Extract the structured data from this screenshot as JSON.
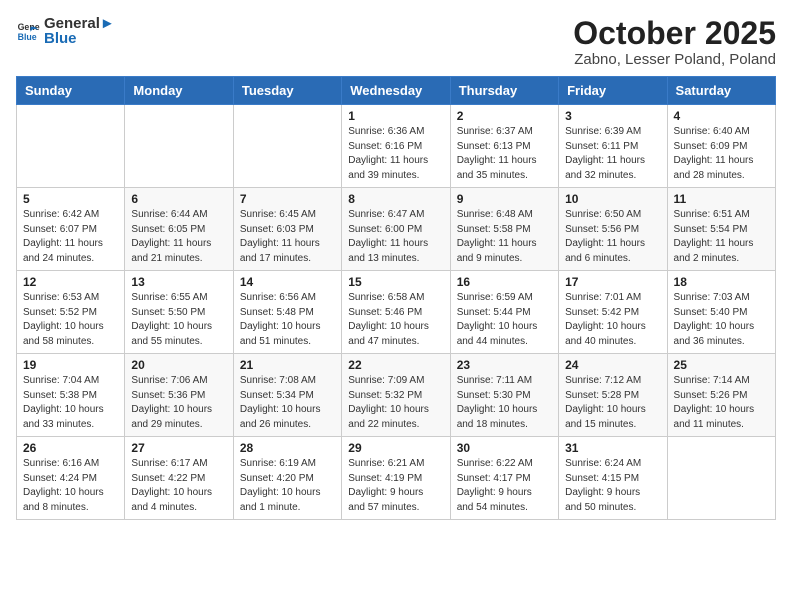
{
  "header": {
    "logo_general": "General",
    "logo_blue": "Blue",
    "month_title": "October 2025",
    "subtitle": "Zabno, Lesser Poland, Poland"
  },
  "weekdays": [
    "Sunday",
    "Monday",
    "Tuesday",
    "Wednesday",
    "Thursday",
    "Friday",
    "Saturday"
  ],
  "weeks": [
    [
      {
        "day": "",
        "info": ""
      },
      {
        "day": "",
        "info": ""
      },
      {
        "day": "",
        "info": ""
      },
      {
        "day": "1",
        "info": "Sunrise: 6:36 AM\nSunset: 6:16 PM\nDaylight: 11 hours\nand 39 minutes."
      },
      {
        "day": "2",
        "info": "Sunrise: 6:37 AM\nSunset: 6:13 PM\nDaylight: 11 hours\nand 35 minutes."
      },
      {
        "day": "3",
        "info": "Sunrise: 6:39 AM\nSunset: 6:11 PM\nDaylight: 11 hours\nand 32 minutes."
      },
      {
        "day": "4",
        "info": "Sunrise: 6:40 AM\nSunset: 6:09 PM\nDaylight: 11 hours\nand 28 minutes."
      }
    ],
    [
      {
        "day": "5",
        "info": "Sunrise: 6:42 AM\nSunset: 6:07 PM\nDaylight: 11 hours\nand 24 minutes."
      },
      {
        "day": "6",
        "info": "Sunrise: 6:44 AM\nSunset: 6:05 PM\nDaylight: 11 hours\nand 21 minutes."
      },
      {
        "day": "7",
        "info": "Sunrise: 6:45 AM\nSunset: 6:03 PM\nDaylight: 11 hours\nand 17 minutes."
      },
      {
        "day": "8",
        "info": "Sunrise: 6:47 AM\nSunset: 6:00 PM\nDaylight: 11 hours\nand 13 minutes."
      },
      {
        "day": "9",
        "info": "Sunrise: 6:48 AM\nSunset: 5:58 PM\nDaylight: 11 hours\nand 9 minutes."
      },
      {
        "day": "10",
        "info": "Sunrise: 6:50 AM\nSunset: 5:56 PM\nDaylight: 11 hours\nand 6 minutes."
      },
      {
        "day": "11",
        "info": "Sunrise: 6:51 AM\nSunset: 5:54 PM\nDaylight: 11 hours\nand 2 minutes."
      }
    ],
    [
      {
        "day": "12",
        "info": "Sunrise: 6:53 AM\nSunset: 5:52 PM\nDaylight: 10 hours\nand 58 minutes."
      },
      {
        "day": "13",
        "info": "Sunrise: 6:55 AM\nSunset: 5:50 PM\nDaylight: 10 hours\nand 55 minutes."
      },
      {
        "day": "14",
        "info": "Sunrise: 6:56 AM\nSunset: 5:48 PM\nDaylight: 10 hours\nand 51 minutes."
      },
      {
        "day": "15",
        "info": "Sunrise: 6:58 AM\nSunset: 5:46 PM\nDaylight: 10 hours\nand 47 minutes."
      },
      {
        "day": "16",
        "info": "Sunrise: 6:59 AM\nSunset: 5:44 PM\nDaylight: 10 hours\nand 44 minutes."
      },
      {
        "day": "17",
        "info": "Sunrise: 7:01 AM\nSunset: 5:42 PM\nDaylight: 10 hours\nand 40 minutes."
      },
      {
        "day": "18",
        "info": "Sunrise: 7:03 AM\nSunset: 5:40 PM\nDaylight: 10 hours\nand 36 minutes."
      }
    ],
    [
      {
        "day": "19",
        "info": "Sunrise: 7:04 AM\nSunset: 5:38 PM\nDaylight: 10 hours\nand 33 minutes."
      },
      {
        "day": "20",
        "info": "Sunrise: 7:06 AM\nSunset: 5:36 PM\nDaylight: 10 hours\nand 29 minutes."
      },
      {
        "day": "21",
        "info": "Sunrise: 7:08 AM\nSunset: 5:34 PM\nDaylight: 10 hours\nand 26 minutes."
      },
      {
        "day": "22",
        "info": "Sunrise: 7:09 AM\nSunset: 5:32 PM\nDaylight: 10 hours\nand 22 minutes."
      },
      {
        "day": "23",
        "info": "Sunrise: 7:11 AM\nSunset: 5:30 PM\nDaylight: 10 hours\nand 18 minutes."
      },
      {
        "day": "24",
        "info": "Sunrise: 7:12 AM\nSunset: 5:28 PM\nDaylight: 10 hours\nand 15 minutes."
      },
      {
        "day": "25",
        "info": "Sunrise: 7:14 AM\nSunset: 5:26 PM\nDaylight: 10 hours\nand 11 minutes."
      }
    ],
    [
      {
        "day": "26",
        "info": "Sunrise: 6:16 AM\nSunset: 4:24 PM\nDaylight: 10 hours\nand 8 minutes."
      },
      {
        "day": "27",
        "info": "Sunrise: 6:17 AM\nSunset: 4:22 PM\nDaylight: 10 hours\nand 4 minutes."
      },
      {
        "day": "28",
        "info": "Sunrise: 6:19 AM\nSunset: 4:20 PM\nDaylight: 10 hours\nand 1 minute."
      },
      {
        "day": "29",
        "info": "Sunrise: 6:21 AM\nSunset: 4:19 PM\nDaylight: 9 hours\nand 57 minutes."
      },
      {
        "day": "30",
        "info": "Sunrise: 6:22 AM\nSunset: 4:17 PM\nDaylight: 9 hours\nand 54 minutes."
      },
      {
        "day": "31",
        "info": "Sunrise: 6:24 AM\nSunset: 4:15 PM\nDaylight: 9 hours\nand 50 minutes."
      },
      {
        "day": "",
        "info": ""
      }
    ]
  ]
}
